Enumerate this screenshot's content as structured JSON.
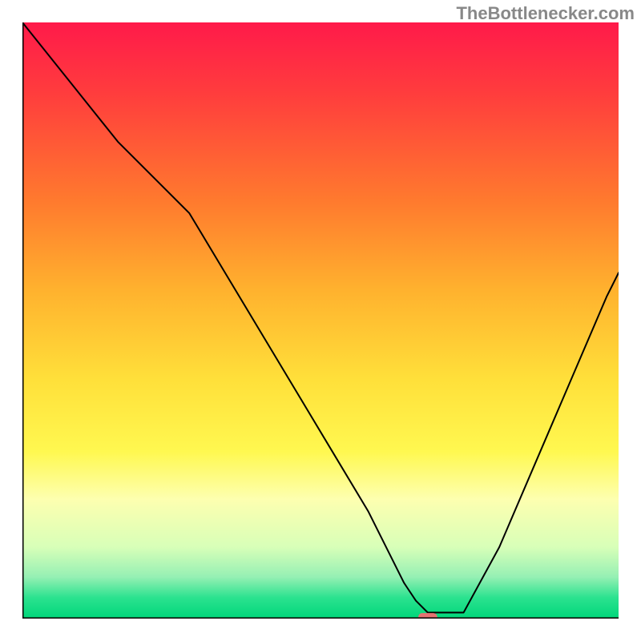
{
  "watermark": "TheBottlenecker.com",
  "chart_data": {
    "type": "line",
    "title": "",
    "xlabel": "",
    "ylabel": "",
    "xlim": [
      0,
      100
    ],
    "ylim": [
      0,
      100
    ],
    "background": {
      "type": "vertical-gradient",
      "stops": [
        {
          "offset": 0.0,
          "color": "#ff1a4a"
        },
        {
          "offset": 0.12,
          "color": "#ff3d3d"
        },
        {
          "offset": 0.3,
          "color": "#ff7a2e"
        },
        {
          "offset": 0.45,
          "color": "#ffb22e"
        },
        {
          "offset": 0.6,
          "color": "#ffe03a"
        },
        {
          "offset": 0.72,
          "color": "#fff850"
        },
        {
          "offset": 0.8,
          "color": "#fdffb0"
        },
        {
          "offset": 0.88,
          "color": "#d8ffb8"
        },
        {
          "offset": 0.93,
          "color": "#96f0b4"
        },
        {
          "offset": 0.965,
          "color": "#2be28f"
        },
        {
          "offset": 1.0,
          "color": "#00d67a"
        }
      ]
    },
    "series": [
      {
        "name": "bottleneck-curve",
        "color": "#000000",
        "width": 2,
        "x": [
          0,
          8,
          16,
          24,
          28,
          34,
          40,
          46,
          52,
          58,
          62,
          64,
          66,
          68,
          70,
          74,
          80,
          86,
          92,
          98,
          100
        ],
        "y": [
          100,
          90,
          80,
          72,
          68,
          58,
          48,
          38,
          28,
          18,
          10,
          6,
          3,
          1,
          1,
          1,
          12,
          26,
          40,
          54,
          58
        ]
      }
    ],
    "marker": {
      "name": "optimal-point",
      "shape": "rounded-rect",
      "color": "#e57373",
      "x": 68,
      "y": 0,
      "width_pct": 3.2,
      "height_pct": 1.3
    },
    "axes": {
      "color": "#000000",
      "width": 3,
      "show_ticks": false
    }
  }
}
